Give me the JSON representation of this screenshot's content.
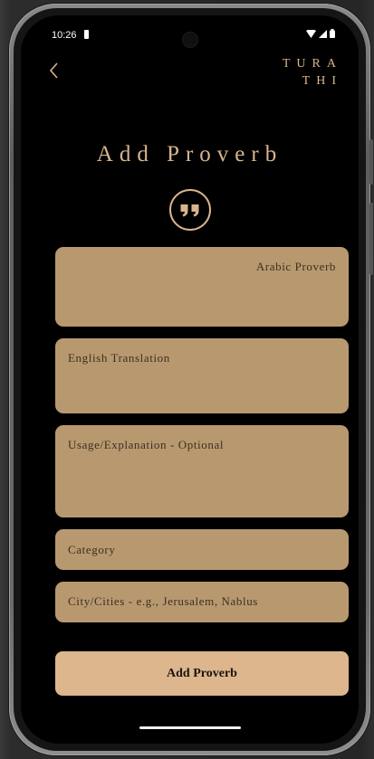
{
  "status_bar": {
    "time": "10:26",
    "icons": [
      "wifi-icon",
      "signal-icon",
      "battery-icon"
    ]
  },
  "header": {
    "back_icon": "chevron-left-icon",
    "brand_line1": "TURA",
    "brand_line2": "THI"
  },
  "page": {
    "title": "Add Proverb",
    "title_icon": "quote-icon"
  },
  "form": {
    "arabic_placeholder": "Arabic Proverb",
    "english_placeholder": "English Translation",
    "usage_placeholder": "Usage/Explanation - Optional",
    "category_placeholder": "Category",
    "city_placeholder": "City/Cities  - e.g., Jerusalem, Nablus",
    "submit_label": "Add Proverb"
  },
  "colors": {
    "accent": "#d9b58c",
    "field_bg": "#b8996f",
    "button_bg": "#ddb68d",
    "background": "#000000"
  }
}
